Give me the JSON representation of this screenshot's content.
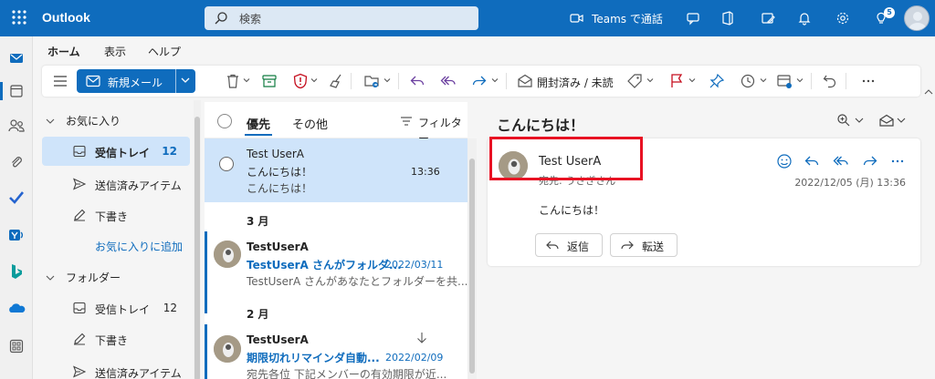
{
  "app": {
    "name": "Outlook"
  },
  "search": {
    "placeholder": "検索"
  },
  "topbar": {
    "teams_label": "Teams で通話",
    "tips_badge": "5"
  },
  "ribbon": {
    "tabs": [
      "ホーム",
      "表示",
      "ヘルプ"
    ],
    "new_mail_label": "新規メール",
    "read_unread_label": "開封済み / 未読"
  },
  "folders": {
    "favorites_label": "お気に入り",
    "favorites": [
      {
        "label": "受信トレイ",
        "count": "12"
      },
      {
        "label": "送信済みアイテム",
        "count": ""
      },
      {
        "label": "下書き",
        "count": ""
      }
    ],
    "add_favorite_label": "お気に入りに追加",
    "folders_label": "フォルダー",
    "folder_items": [
      {
        "label": "受信トレイ",
        "count": "12"
      },
      {
        "label": "下書き",
        "count": ""
      },
      {
        "label": "送信済みアイテム",
        "count": ""
      }
    ]
  },
  "message_list": {
    "tabs": [
      "優先",
      "その他"
    ],
    "filter_label": "フィルター",
    "messages": [
      {
        "sender": "Test UserA",
        "subject": "こんにちは！",
        "preview": "こんにちは！",
        "date": "13:36"
      },
      {
        "sender": "TestUserA",
        "subject": "TestUserA さんがフォルダ...",
        "preview": "TestUserA さんがあなたとフォルダーを共...",
        "date": "2022/03/11"
      },
      {
        "sender": "TestUserA",
        "subject": "期限切れリマインダ自動...",
        "preview": "宛先各位 下記メンバーの有効期限が近...",
        "date": "2022/02/09"
      }
    ],
    "groups": [
      "3 月",
      "2 月"
    ]
  },
  "reading": {
    "subject": "こんにちは！",
    "sender": "Test UserA",
    "to": "宛先: うさぎさん",
    "date": "2022/12/05 (月) 13:36",
    "body": "こんにちは！",
    "reply_label": "返信",
    "forward_label": "転送"
  },
  "colors": {
    "brand": "#0f6cbd",
    "selected": "#cfe4fa",
    "highlight": "#e81123"
  }
}
